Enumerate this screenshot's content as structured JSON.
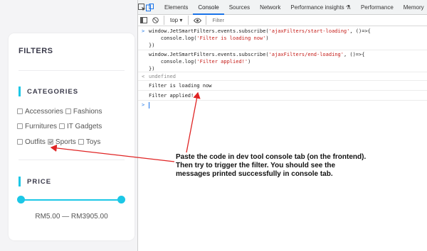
{
  "filters": {
    "title": "FILTERS",
    "categories": {
      "heading": "CATEGORIES",
      "rows": [
        [
          {
            "label": "Accessories",
            "checked": false
          },
          {
            "label": "Fashions",
            "checked": false
          }
        ],
        [
          {
            "label": "Furnitures",
            "checked": false
          },
          {
            "label": "IT Gadgets",
            "checked": false
          }
        ],
        [
          {
            "label": "Outfits",
            "checked": false
          },
          {
            "label": "Sports",
            "checked": true
          },
          {
            "label": "Toys",
            "checked": false
          }
        ]
      ]
    },
    "price": {
      "heading": "PRICE",
      "range_text": "RM5.00 — RM3905.00"
    },
    "accent_color": "#1cc7e6"
  },
  "devtools": {
    "tabs": [
      "Elements",
      "Console",
      "Sources",
      "Network",
      "Performance insights ⚗",
      "Performance",
      "Memory"
    ],
    "active_tab": "Console",
    "context": "top ▾",
    "filter_placeholder": "Filter",
    "console_lines": [
      {
        "prompt": ">",
        "parts": [
          {
            "t": "window.JetSmartFilters.events.subscribe(",
            "s": false
          },
          {
            "t": "'ajaxFilters/start-loading'",
            "s": true
          },
          {
            "t": ", ()=>{",
            "s": false
          }
        ]
      },
      {
        "prompt": "",
        "parts": [
          {
            "t": "    console.log(",
            "s": false
          },
          {
            "t": "'Filter is loading now'",
            "s": true
          },
          {
            "t": ")",
            "s": false
          }
        ]
      },
      {
        "prompt": "",
        "parts": [
          {
            "t": "})",
            "s": false
          }
        ]
      },
      {
        "prompt": "",
        "parts": [
          {
            "t": "window.JetSmartFilters.events.subscribe(",
            "s": false
          },
          {
            "t": "'ajaxFilters/end-loading'",
            "s": true
          },
          {
            "t": ", ()=>{",
            "s": false
          }
        ]
      },
      {
        "prompt": "",
        "parts": [
          {
            "t": "    console.log(",
            "s": false
          },
          {
            "t": "'Filter applied!'",
            "s": true
          },
          {
            "t": ")",
            "s": false
          }
        ]
      },
      {
        "prompt": "",
        "parts": [
          {
            "t": "})",
            "s": false
          }
        ]
      },
      {
        "prompt": "<",
        "parts": [
          {
            "t": "undefined",
            "s": false,
            "m": true
          }
        ]
      },
      {
        "prompt": "",
        "parts": [
          {
            "t": "Filter is loading now",
            "s": false
          }
        ]
      },
      {
        "prompt": "",
        "parts": [
          {
            "t": "Filter applied!",
            "s": false
          }
        ]
      }
    ]
  },
  "annotation": {
    "text": "Paste the code in dev tool console tab (on the frontend). Then try to trigger the filter. You should see the messages printed successfully in console tab.",
    "arrow_color": "#e02424"
  }
}
